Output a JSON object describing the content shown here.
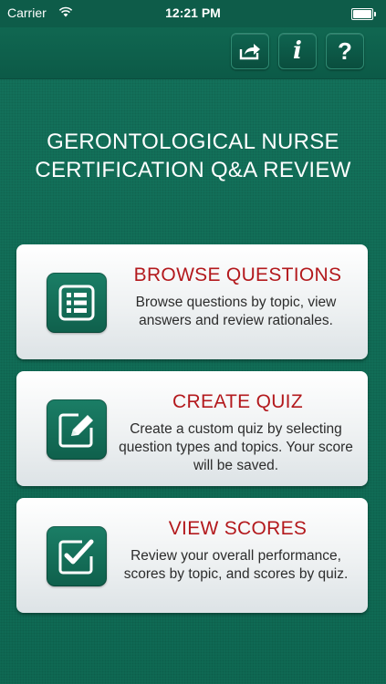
{
  "status_bar": {
    "carrier": "Carrier",
    "time": "12:21 PM"
  },
  "nav": {
    "buttons": [
      {
        "icon": "share-icon",
        "glyph": "⇪"
      },
      {
        "icon": "info-icon",
        "glyph": "i"
      },
      {
        "icon": "help-icon",
        "glyph": "?"
      }
    ]
  },
  "title_line1": "GERONTOLOGICAL NURSE",
  "title_line2": "CERTIFICATION Q&A REVIEW",
  "cards": [
    {
      "heading": "BROWSE QUESTIONS",
      "description": "Browse questions by topic, view answers and review rationales.",
      "icon": "list-icon"
    },
    {
      "heading": "CREATE QUIZ",
      "description": "Create a custom quiz by selecting question types and topics. Your score will be saved.",
      "icon": "edit-icon"
    },
    {
      "heading": "VIEW SCORES",
      "description": "Review your overall performance, scores by topic, and scores by quiz.",
      "icon": "checkbox-icon"
    }
  ],
  "colors": {
    "background": "#12705a",
    "heading": "#b3191d",
    "icon_tile": "#166e58"
  }
}
